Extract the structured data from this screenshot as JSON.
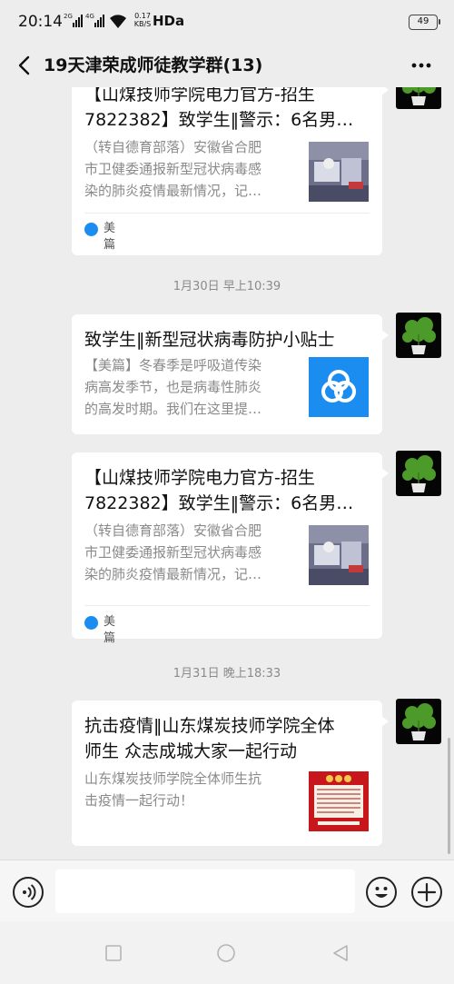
{
  "status_bar": {
    "time": "20:14",
    "sim1_label": "2G",
    "sim2_label": "4G",
    "net_speed_value": "0.17",
    "net_speed_unit": "KB/S",
    "network_label": "HDa",
    "battery_level": "49"
  },
  "nav": {
    "title": "19天津荣成师徒教学群(13)"
  },
  "messages": [
    {
      "title": "【山煤技师学院电力官方-招生\n7822382】致学生‖警示：6名男…",
      "description": "（转自德育部落）安徽省合肥\n市卫健委通报新型冠状病毒感\n染的肺炎疫情最新情况，记…",
      "source": "美篇",
      "thumbnail": "hospital-photo"
    },
    {
      "title": "致学生‖新型冠状病毒防护小贴士",
      "description": "【美篇】冬春季是呼吸道传染\n病高发季节，也是病毒性肺炎\n的高发时期。我们在这里提…",
      "thumbnail": "meipian-logo"
    },
    {
      "title": "【山煤技师学院电力官方-招生\n7822382】致学生‖警示：6名男…",
      "description": "（转自德育部落）安徽省合肥\n市卫健委通报新型冠状病毒感\n染的肺炎疫情最新情况，记…",
      "source": "美篇",
      "thumbnail": "hospital-photo"
    },
    {
      "title": "抗击疫情‖山东煤炭技师学院全体\n师生 众志成城大家一起行动",
      "description": "山东煤炭技师学院全体师生抗\n击疫情一起行动！",
      "thumbnail": "red-poster"
    }
  ],
  "timestamps": [
    "1月30日 早上10:39",
    "1月31日 晚上18:33"
  ],
  "input": {
    "placeholder": ""
  },
  "colors": {
    "background": "#ededed",
    "card": "#ffffff",
    "meipian_blue": "#1c8df0",
    "poster_red": "#c8161d"
  }
}
